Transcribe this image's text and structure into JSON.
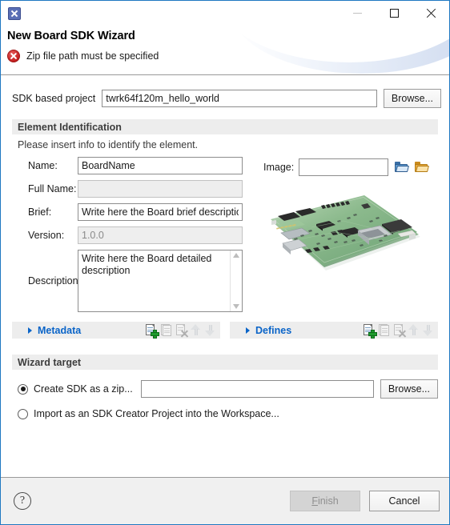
{
  "window": {
    "icon_name": "app-x-icon",
    "title": "New Board SDK Wizard",
    "minimize_label": "—",
    "maximize_label": "□",
    "close_label": "✕"
  },
  "header": {
    "title": "New Board SDK Wizard",
    "error_icon": "error-circle-icon",
    "error_message": "Zip file path must be specified"
  },
  "sdk_project": {
    "label": "SDK based project",
    "value": "twrk64f120m_hello_world",
    "placeholder": "",
    "browse_label": "Browse..."
  },
  "element_identification": {
    "header": "Element Identification",
    "subtitle": "Please insert info to identify the element.",
    "fields": [
      {
        "label": "Name:",
        "value": "BoardName",
        "enabled": true
      },
      {
        "label": "Full Name:",
        "value": "",
        "enabled": false
      },
      {
        "label": "Brief:",
        "value": "Write here the Board brief description",
        "enabled": true
      },
      {
        "label": "Version:",
        "value": "1.0.0",
        "enabled": false
      }
    ],
    "description": {
      "label": "Description:",
      "value": "Write here the Board detailed description",
      "scroll_up_icon": "chevron-up-icon",
      "scroll_down_icon": "chevron-down-icon"
    },
    "image": {
      "label": "Image:",
      "value": "",
      "browse_workspace_icon": "folder-blue-icon",
      "browse_filesystem_icon": "folder-orange-icon",
      "preview_alt": "development board photo"
    }
  },
  "sections": [
    {
      "label": "Metadata",
      "expander_icon": "triangle-right-icon",
      "tools": [
        {
          "name": "add-metadata-icon",
          "label": "Add",
          "enabled": true
        },
        {
          "name": "duplicate-metadata-icon",
          "label": "Duplicate",
          "enabled": false
        },
        {
          "name": "delete-metadata-icon",
          "label": "Delete",
          "enabled": false
        },
        {
          "name": "move-up-icon",
          "label": "Move Up",
          "enabled": false
        },
        {
          "name": "move-down-icon",
          "label": "Move Down",
          "enabled": false
        }
      ]
    },
    {
      "label": "Defines",
      "expander_icon": "triangle-right-icon",
      "tools": [
        {
          "name": "add-define-icon",
          "label": "Add",
          "enabled": true
        },
        {
          "name": "duplicate-define-icon",
          "label": "Duplicate",
          "enabled": false
        },
        {
          "name": "delete-define-icon",
          "label": "Delete",
          "enabled": false
        },
        {
          "name": "move-up-icon",
          "label": "Move Up",
          "enabled": false
        },
        {
          "name": "move-down-icon",
          "label": "Move Down",
          "enabled": false
        }
      ]
    }
  ],
  "wizard_target": {
    "header": "Wizard target",
    "option_zip": {
      "label": "Create SDK as a zip...",
      "selected": true,
      "path_value": "",
      "browse_label": "Browse..."
    },
    "option_import": {
      "label": "Import as an SDK Creator Project into the Workspace...",
      "selected": false
    }
  },
  "footer": {
    "help_icon": "help-question-icon",
    "help_glyph": "?",
    "finish_label": "Finish",
    "finish_enabled": false,
    "cancel_label": "Cancel",
    "cancel_enabled": true
  },
  "colors": {
    "window_border": "#1f78c1",
    "accent_link": "#0a64c8",
    "error_red": "#c62020",
    "group_header_bg": "#ededed",
    "footer_bg": "#f0f0f0",
    "add_green": "#1f9a2e"
  }
}
